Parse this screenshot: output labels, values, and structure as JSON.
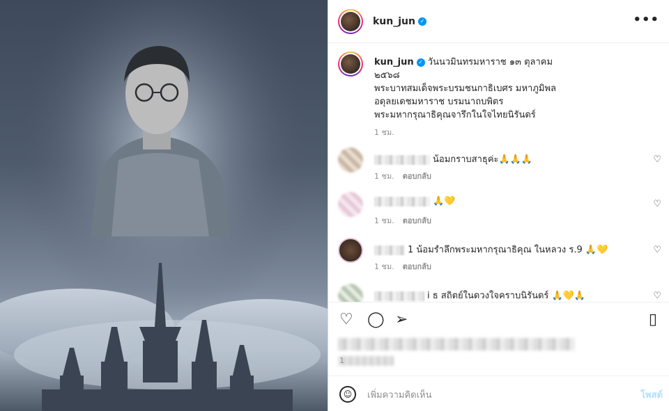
{
  "post": {
    "username": "kun_jun",
    "verified_mark": "✓",
    "more_label": "•••"
  },
  "caption": {
    "username": "kun_jun",
    "lines": [
      "วันนวมินทรมหาราช ๑๓ ตุลาคม",
      "๒๕๖๘",
      "พระบาทสมเด็จพระบรมชนกาธิเบศร มหาภูมิพล",
      "อดุลยเดชมหาราช บรมนาถบพิตร",
      "พระมหากรุณาธิคุณจารึกในใจไทยนิรันดร์"
    ],
    "time": "1 ชม."
  },
  "comments": [
    {
      "text": "น้อมกราบสาธุค่ะ🙏🙏🙏",
      "time": "1 ชม.",
      "reply": "ตอบกลับ"
    },
    {
      "text": "🙏💛",
      "time": "1 ชม.",
      "reply": "ตอบกลับ"
    },
    {
      "text": "1 น้อมรำลึกพระมหากรุณาธิคุณ ในหลวง ร.9 🙏💛",
      "time": "1 ชม.",
      "reply": "ตอบกลับ"
    },
    {
      "text": "i ธ สถิตย์ในดวงใจคราบนิรันดร์ 🙏💛🙏",
      "time": "",
      "reply": ""
    }
  ],
  "icons": {
    "heart": "heart-icon",
    "comment": "comment-icon",
    "share": "share-icon",
    "bookmark": "bookmark-icon",
    "emoji": "emoji-icon",
    "more": "more-icon"
  },
  "likes": {
    "count_prefix": "1"
  },
  "add_comment": {
    "placeholder": "เพิ่มความคิดเห็น",
    "post_label": "โพสต์"
  },
  "colors": {
    "accent": "#0095f6",
    "post_disabled": "#b2dffc"
  }
}
